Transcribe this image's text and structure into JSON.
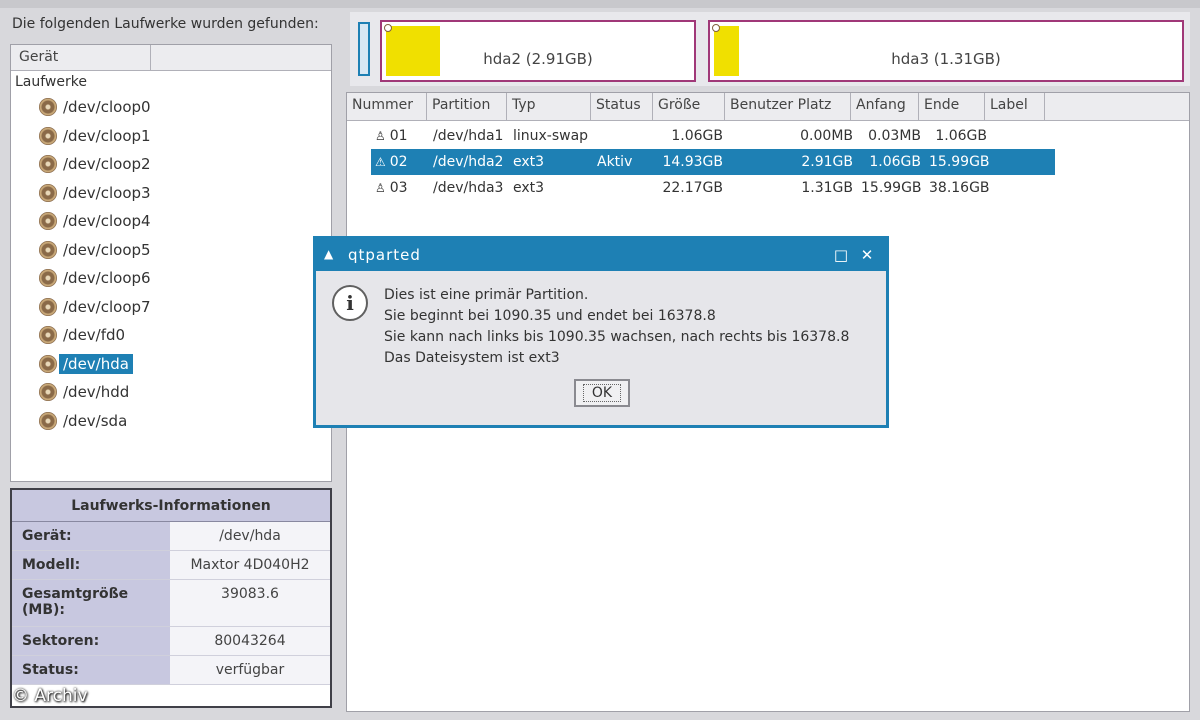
{
  "left": {
    "found_label": "Die folgenden Laufwerke wurden gefunden:",
    "tree_header": [
      "Gerät",
      ""
    ],
    "tree_root": "Laufwerke",
    "devices": [
      "/dev/cloop0",
      "/dev/cloop1",
      "/dev/cloop2",
      "/dev/cloop3",
      "/dev/cloop4",
      "/dev/cloop5",
      "/dev/cloop6",
      "/dev/cloop7",
      "/dev/fd0",
      "/dev/hda",
      "/dev/hdd",
      "/dev/sda"
    ],
    "selected_device": "/dev/hda"
  },
  "info": {
    "title": "Laufwerks-Informationen",
    "rows": [
      {
        "key": "Gerät:",
        "value": "/dev/hda"
      },
      {
        "key": "Modell:",
        "value": "Maxtor 4D040H2"
      },
      {
        "key": "Gesamtgröße (MB):",
        "value": "39083.6"
      },
      {
        "key": "Sektoren:",
        "value": "80043264"
      },
      {
        "key": "Status:",
        "value": "verfügbar"
      }
    ]
  },
  "watermark": "© Archiv",
  "partition_bar": {
    "parts": [
      {
        "label": "hda2 (2.91GB)",
        "fill_fraction": 0.2
      },
      {
        "label": "hda3 (1.31GB)",
        "fill_fraction": 0.07
      }
    ],
    "colors": {
      "border": "#a03878",
      "fill": "#f0e000"
    }
  },
  "table": {
    "columns": [
      "Nummer",
      "Partition",
      "Typ",
      "Status",
      "Größe",
      "Benutzer Platz",
      "Anfang",
      "Ende",
      "Label"
    ],
    "rows": [
      {
        "num": "01",
        "icon": "linux-icon",
        "partition": "/dev/hda1",
        "type": "linux-swap",
        "status": "",
        "size": "1.06GB",
        "used": "0.00MB",
        "start": "0.03MB",
        "end": "1.06GB",
        "selected": false
      },
      {
        "num": "02",
        "icon": "warning-icon",
        "partition": "/dev/hda2",
        "type": "ext3",
        "status": "Aktiv",
        "size": "14.93GB",
        "used": "2.91GB",
        "start": "1.06GB",
        "end": "15.99GB",
        "selected": true
      },
      {
        "num": "03",
        "icon": "linux-icon",
        "partition": "/dev/hda3",
        "type": "ext3",
        "status": "",
        "size": "22.17GB",
        "used": "1.31GB",
        "start": "15.99GB",
        "end": "38.16GB",
        "selected": false
      }
    ]
  },
  "dialog": {
    "title": "qtparted",
    "lines": [
      "Dies ist eine primär Partition.",
      "Sie beginnt bei 1090.35 und endet bei 16378.8",
      "Sie kann nach links bis 1090.35 wachsen, nach rechts bis 16378.8",
      "Das Dateisystem ist ext3"
    ],
    "ok_label": "OK",
    "accent": "#1e80b4"
  }
}
